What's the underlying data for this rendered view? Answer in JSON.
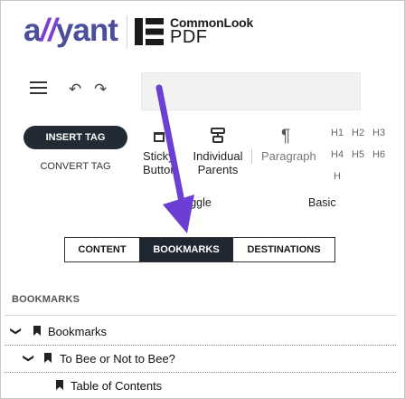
{
  "header": {
    "brand_allyant_a": "a",
    "brand_allyant_slash": "//",
    "brand_allyant_rest": "yant",
    "product_name": "CommonLook",
    "product_sub": "PDF"
  },
  "toolbar": {
    "menu_icon": "hamburger-icon",
    "undo_glyph": "↶",
    "redo_glyph": "↷",
    "search_value": "",
    "search_placeholder": ""
  },
  "ribbon": {
    "insert_tag": "INSERT TAG",
    "convert_tag": "CONVERT TAG",
    "sticky_buttons_line1": "Sticky",
    "sticky_buttons_line2": "Buttons",
    "individual_parents_line1": "Individual",
    "individual_parents_line2": "Parents",
    "paragraph": "Paragraph",
    "headings": [
      "H1",
      "H2",
      "H3",
      "H4",
      "H5",
      "H6",
      "H"
    ],
    "group_toggle": "Toggle",
    "group_basic": "Basic"
  },
  "tabs": {
    "content": "CONTENT",
    "bookmarks": "BOOKMARKS",
    "destinations": "DESTINATIONS",
    "active": "BOOKMARKS"
  },
  "panel": {
    "title": "BOOKMARKS",
    "tree": [
      {
        "label": "Bookmarks",
        "expanded": true,
        "level": 0
      },
      {
        "label": "To Bee or Not to Bee?",
        "expanded": true,
        "level": 1
      },
      {
        "label": "Table of Contents",
        "expanded": false,
        "level": 2
      }
    ]
  },
  "colors": {
    "allyant": "#4b4f9b",
    "accent_purple": "#6b3fd3",
    "dark_button": "#222a33",
    "active_tab": "#1f2732"
  }
}
